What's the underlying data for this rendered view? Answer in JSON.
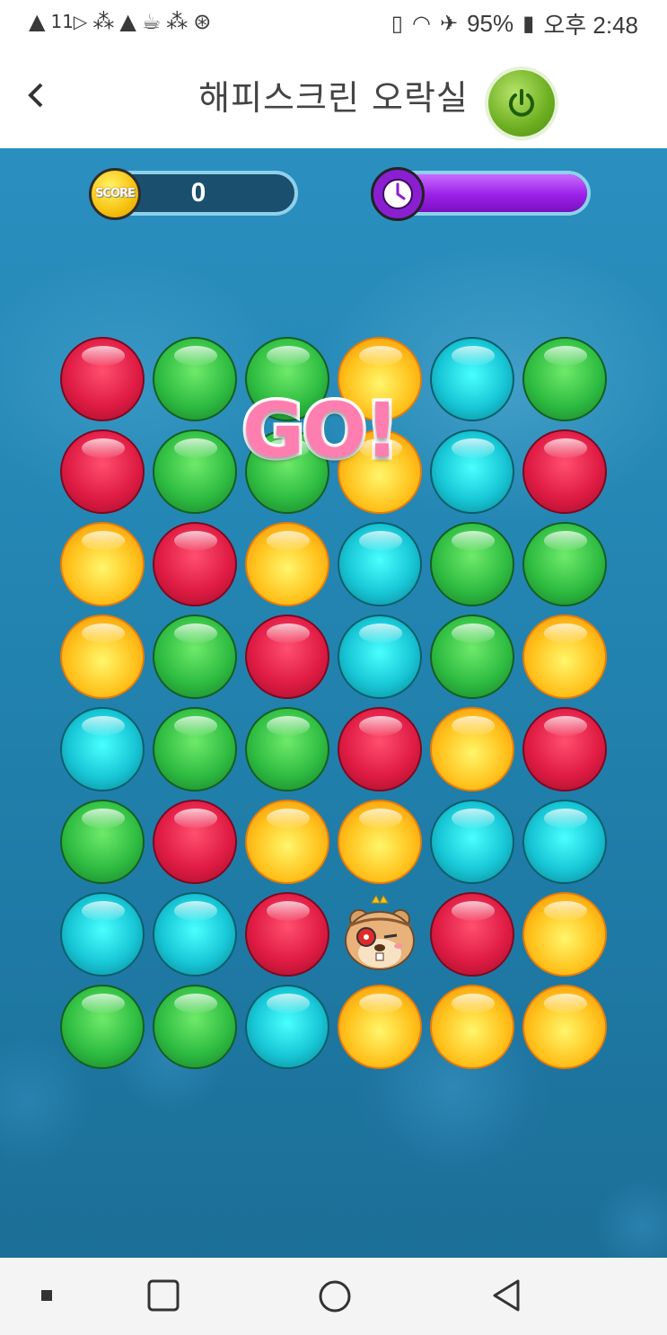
{
  "status_bar": {
    "left_text": "11▷",
    "battery": "95%",
    "time": "오후 2:48"
  },
  "header": {
    "title": "해피스크린 오락실"
  },
  "game": {
    "score": "0",
    "score_badge": "SCORE",
    "timer_fraction": 1.0,
    "banner": "GO!",
    "board": [
      [
        "red",
        "green",
        "green",
        "yellow",
        "cyan",
        "green"
      ],
      [
        "red",
        "green",
        "green",
        "yellow",
        "cyan",
        "red"
      ],
      [
        "yellow",
        "red",
        "yellow",
        "cyan",
        "green",
        "green"
      ],
      [
        "yellow",
        "green",
        "red",
        "cyan",
        "green",
        "yellow"
      ],
      [
        "cyan",
        "green",
        "green",
        "red",
        "yellow",
        "red"
      ],
      [
        "green",
        "red",
        "yellow",
        "yellow",
        "cyan",
        "cyan"
      ],
      [
        "cyan",
        "cyan",
        "red",
        "hamster",
        "red",
        "yellow"
      ],
      [
        "green",
        "green",
        "cyan",
        "yellow",
        "yellow",
        "yellow"
      ]
    ]
  },
  "colors": {
    "accent": "#9b20e8",
    "power": "#6cae20"
  }
}
